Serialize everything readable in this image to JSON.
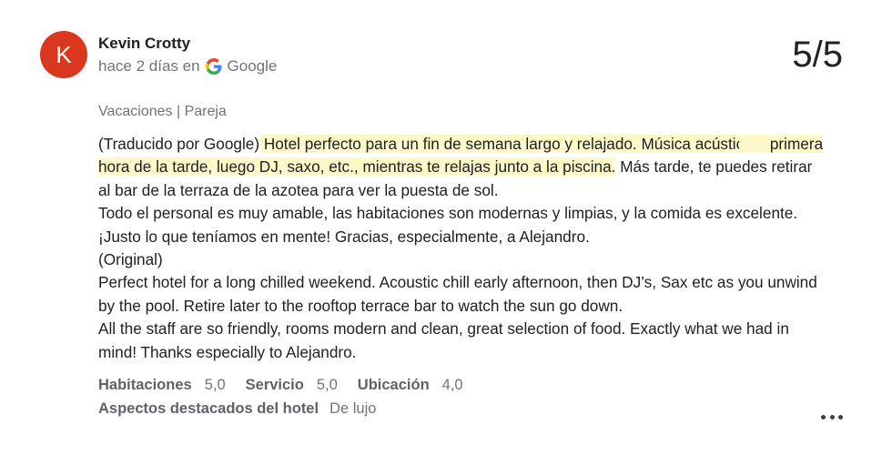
{
  "reviewer": {
    "initial": "K",
    "name": "Kevin Crotty",
    "avatar_color": "#d9381e"
  },
  "meta": {
    "when_prefix": "hace 2 días en",
    "source_icon": "google-g-icon",
    "source": "Google"
  },
  "score": "5/5",
  "trip_type": "Vacaciones | Pareja",
  "review": {
    "translated_prefix": "(Traducido por Google) ",
    "translated_highlight_1": "Hotel perfecto para un fin de semana largo y relajado. Música acústica a",
    "translated_highlight_2": "primera hora de la tarde, luego DJ, saxo, etc., mientras te relajas junto a la piscina",
    "translated_rest_1": ". Más tarde, te puedes retirar al bar de la terraza de la azotea para ver la puesta de sol.",
    "translated_rest_2": "Todo el personal es muy amable, las habitaciones son modernas y limpias, y la comida es excelente. ¡Justo lo que teníamos en mente! Gracias, especialmente, a Alejandro.",
    "original_label": "(Original)",
    "original_1": "Perfect hotel for a long chilled weekend. Acoustic chill early afternoon, then DJ’s, Sax etc as you unwind by the pool. Retire later to the rooftop terrace bar to watch the sun go down.",
    "original_2": "All the staff are so friendly, rooms modern and clean, great selection of food. Exactly what we had in mind! Thanks especially to Alejandro."
  },
  "ratings": [
    {
      "label": "Habitaciones",
      "value": "5,0"
    },
    {
      "label": "Servicio",
      "value": "5,0"
    },
    {
      "label": "Ubicación",
      "value": "4,0"
    }
  ],
  "highlights": {
    "label": "Aspectos destacados del hotel",
    "value": "De lujo"
  },
  "actions": {
    "more_icon": "more-horiz-icon"
  },
  "colors": {
    "highlight": "#fff8c8",
    "muted_text": "#70757a"
  }
}
